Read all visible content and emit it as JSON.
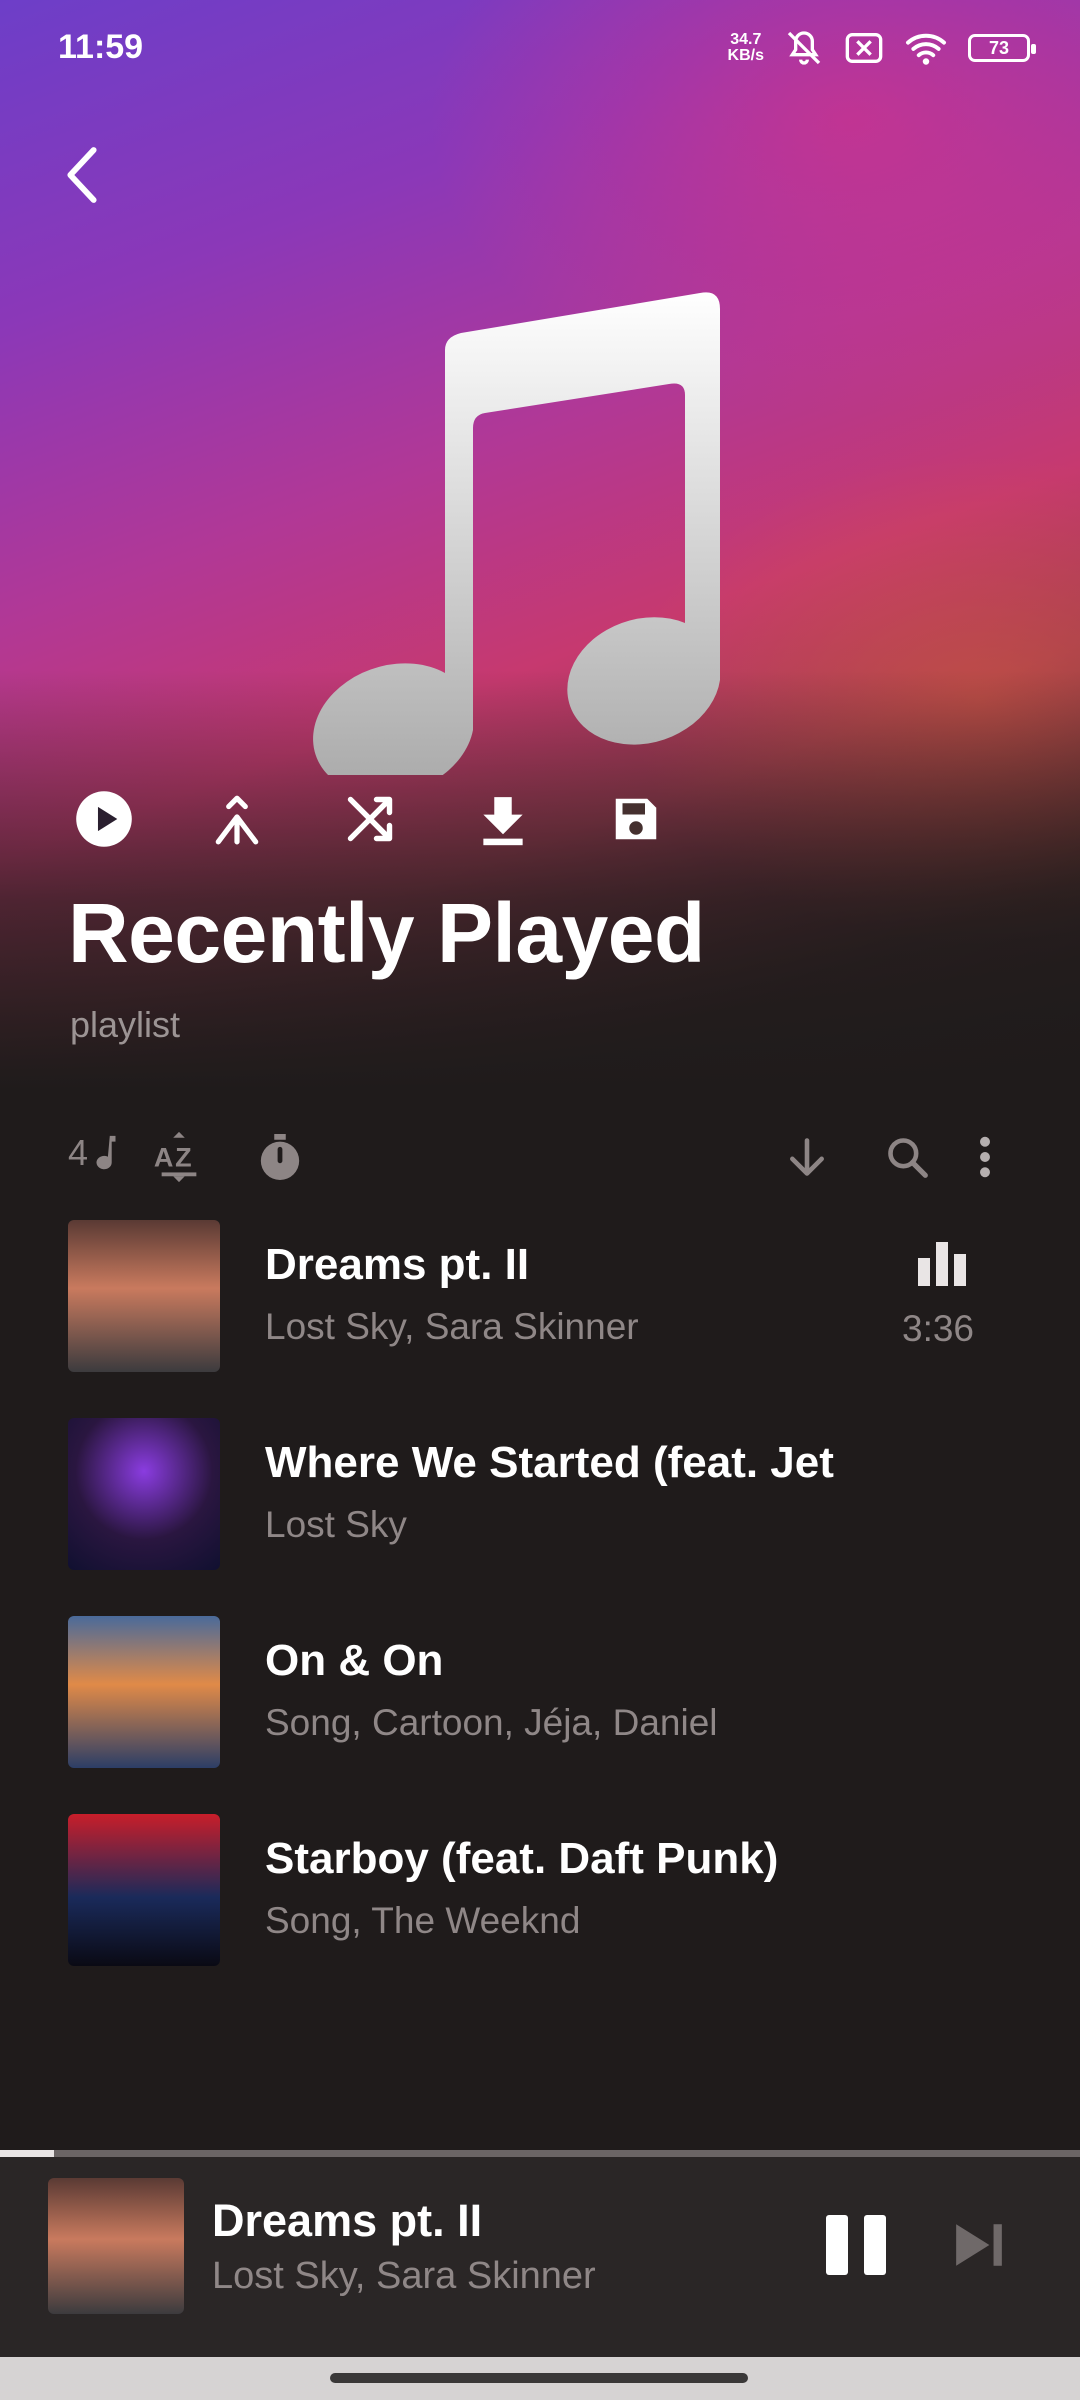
{
  "status_bar": {
    "time": "11:59",
    "speed_value": "34.7",
    "speed_unit": "KB/s",
    "battery": "73",
    "icons": [
      "mute-icon",
      "no-sim-icon",
      "wifi-icon",
      "battery-icon"
    ]
  },
  "header": {
    "back_icon": "chevron-left-icon",
    "artwork_icon": "music-note-icon",
    "actions": [
      "play-icon",
      "merge-icon",
      "shuffle-icon",
      "download-icon",
      "save-icon"
    ],
    "title": "Recently Played",
    "subtitle": "playlist"
  },
  "toolbar": {
    "count": "4",
    "icons": [
      "music-note-icon",
      "sort-az-icon",
      "timer-icon",
      "arrow-down-icon",
      "search-icon",
      "more-vert-icon"
    ]
  },
  "tracks": [
    {
      "title": "Dreams pt. II",
      "artists": "Lost Sky, Sara Skinner",
      "duration": "3:36",
      "playing": true,
      "art_colors": [
        "#5a3a34",
        "#c97a5e",
        "#3c3b3e"
      ]
    },
    {
      "title": "Where We Started (feat. Jethro Sheeran)",
      "artists": "Lost Sky",
      "duration": "",
      "playing": false,
      "art_colors": [
        "#2a1640",
        "#8a3ce0",
        "#101030"
      ]
    },
    {
      "title": "On & On",
      "artists": "Song, Cartoon, Jéja, Daniel",
      "duration": "",
      "playing": false,
      "art_colors": [
        "#e08a48",
        "#4a6a9a",
        "#2c3e66"
      ]
    },
    {
      "title": "Starboy (feat. Daft Punk)",
      "artists": "Song, The Weeknd",
      "duration": "",
      "playing": false,
      "art_colors": [
        "#c81e2a",
        "#1a2a5a",
        "#0a0a14"
      ]
    }
  ],
  "now_playing": {
    "title": "Dreams pt. II",
    "artists": "Lost Sky, Sara Skinner",
    "progress": 0.05,
    "controls": [
      "pause-icon",
      "skip-next-icon"
    ]
  },
  "colors": {
    "background": "#1f1b1b",
    "secondary_text": "#8f8787",
    "gradient_top": "#6d3ec8",
    "gradient_mid": "#c6396f"
  }
}
